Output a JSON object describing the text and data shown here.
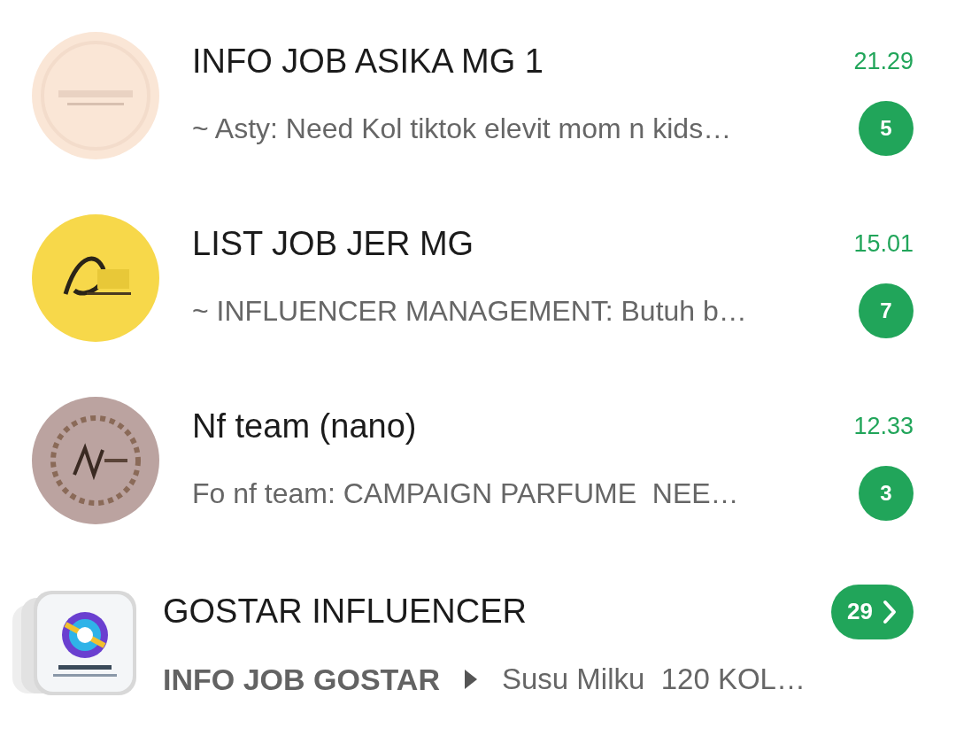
{
  "chats": [
    {
      "kind": "chat",
      "title": "INFO JOB ASIKA MG 1",
      "preview": "~ Asty: Need Kol tiktok elevit mom n kids…",
      "time": "21.29",
      "unread": "5"
    },
    {
      "kind": "chat",
      "title": "LIST JOB JER MG",
      "preview": "~ INFLUENCER MANAGEMENT: Butuh b…",
      "time": "15.01",
      "unread": "7"
    },
    {
      "kind": "chat",
      "title": "Nf team (nano)",
      "preview": "Fo nf team: CAMPAIGN PARFUME  NEE…",
      "time": "12.33",
      "unread": "3"
    },
    {
      "kind": "community",
      "title": "GOSTAR INFLUENCER",
      "group": "INFO JOB GOSTAR",
      "preview": "Susu Milku  120 KOL…",
      "unread": "29"
    }
  ]
}
